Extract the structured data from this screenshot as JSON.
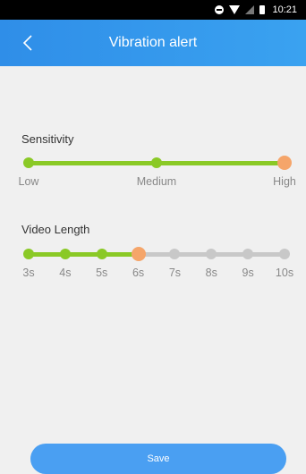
{
  "status_bar": {
    "time": "10:21"
  },
  "header": {
    "title": "Vibration alert"
  },
  "sensitivity": {
    "label": "Sensitivity",
    "levels": [
      "Low",
      "Medium",
      "High"
    ],
    "selected_index": 2
  },
  "video_length": {
    "label": "Video Length",
    "options": [
      "3s",
      "4s",
      "5s",
      "6s",
      "7s",
      "8s",
      "9s",
      "10s"
    ],
    "selected_index": 3
  },
  "save_label": "Save",
  "colors": {
    "accent_green": "#8ac926",
    "knob_active": "#f5a56a",
    "track_inactive": "#c8c8c8",
    "header_blue": "#3399ee",
    "button_blue": "#4a9ff2"
  }
}
